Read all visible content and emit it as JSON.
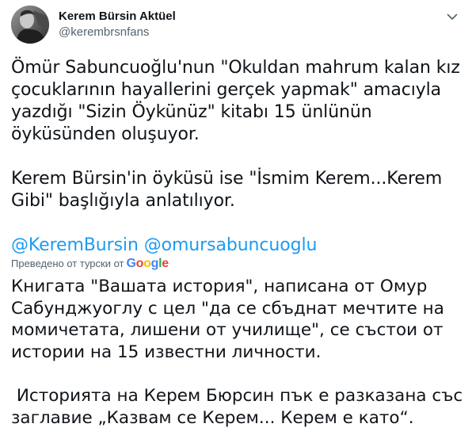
{
  "tweet": {
    "author": {
      "display_name": "Kerem Bürsin Aktüel",
      "handle": "@kerembrsnfans"
    },
    "more_icon": "chevron-down-icon",
    "text": {
      "paragraph_1": "Ömür Sabuncuoğlu'nun \"Okuldan mahrum kalan kız çocuklarının hayallerini gerçek yapmak\" amacıyla yazdığı \"Sizin Öykünüz\" kitabı 15 ünlünün öyküsünden oluşuyor.",
      "paragraph_2": "Kerem Bürsin'in öyküsü ise \"İsmim Kerem...Kerem Gibi\" başlığıyla anlatılıyor.",
      "mention_1": "@KeremBursin",
      "mention_2": "@omursabuncuoglu"
    },
    "translation": {
      "label": "Преведено от турски от",
      "provider": "Google",
      "paragraph_1": "Книгата \"Вашата история\", написана от Омур Сабунджуоглу с цел \"да се сбъднат мечтите на момичетата, лишени от училище\", се състои от истории на 15 известни личности.",
      "paragraph_2": " Историята на Керем Бюрсин пък е разказана със заглавие „Казвам се Керем... Керем е като“."
    },
    "colors": {
      "text": "#0f1419",
      "secondary": "#536471",
      "link": "#1d9bf0",
      "google_blue": "#4285f4",
      "google_red": "#ea4335",
      "google_yellow": "#fbbc05",
      "google_green": "#34a853"
    }
  }
}
